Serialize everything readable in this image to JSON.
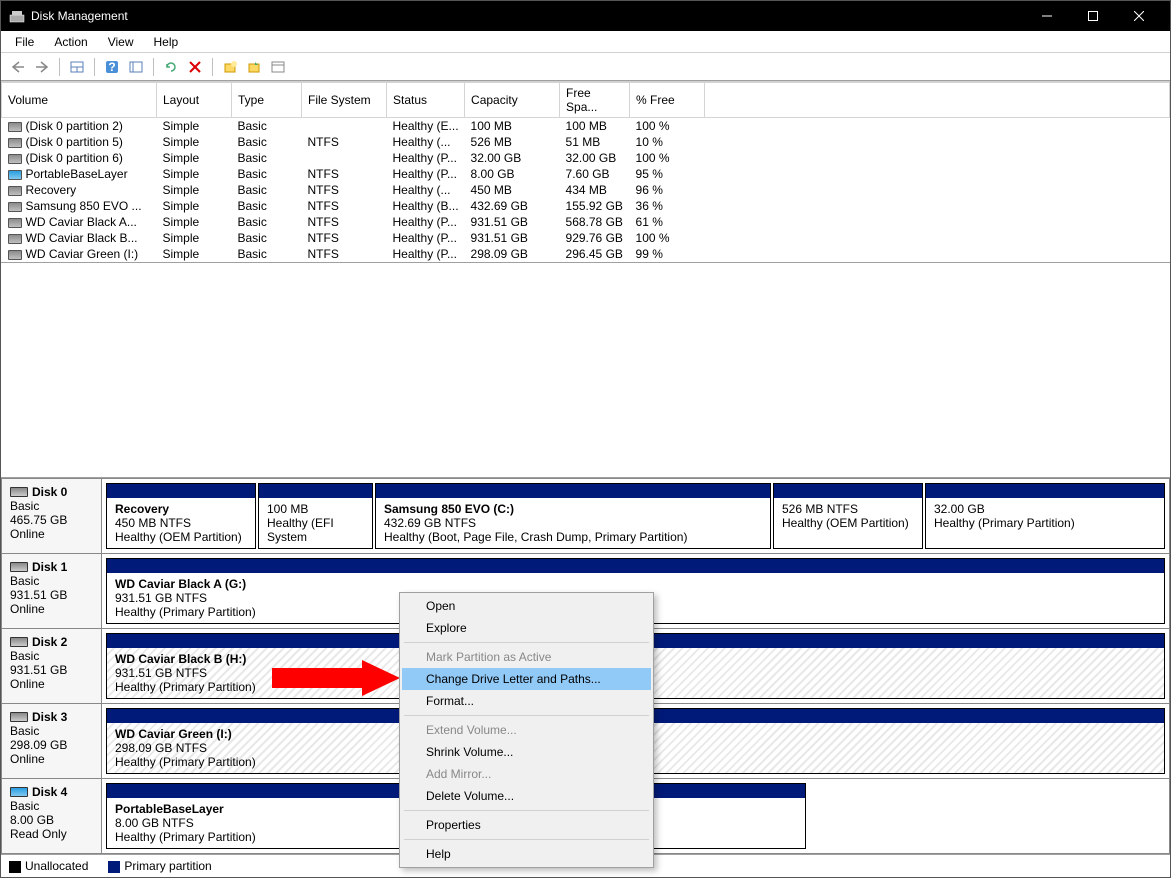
{
  "window": {
    "title": "Disk Management"
  },
  "menu": {
    "file": "File",
    "action": "Action",
    "view": "View",
    "help": "Help"
  },
  "columns": {
    "volume": "Volume",
    "layout": "Layout",
    "type": "Type",
    "fs": "File System",
    "status": "Status",
    "capacity": "Capacity",
    "free": "Free Spa...",
    "pct": "% Free"
  },
  "volumes": [
    {
      "name": "(Disk 0 partition 2)",
      "layout": "Simple",
      "type": "Basic",
      "fs": "",
      "status": "Healthy (E...",
      "cap": "100 MB",
      "free": "100 MB",
      "pct": "100 %",
      "icon": "gray"
    },
    {
      "name": "(Disk 0 partition 5)",
      "layout": "Simple",
      "type": "Basic",
      "fs": "NTFS",
      "status": "Healthy (...",
      "cap": "526 MB",
      "free": "51 MB",
      "pct": "10 %",
      "icon": "gray"
    },
    {
      "name": "(Disk 0 partition 6)",
      "layout": "Simple",
      "type": "Basic",
      "fs": "",
      "status": "Healthy (P...",
      "cap": "32.00 GB",
      "free": "32.00 GB",
      "pct": "100 %",
      "icon": "gray"
    },
    {
      "name": "PortableBaseLayer",
      "layout": "Simple",
      "type": "Basic",
      "fs": "NTFS",
      "status": "Healthy (P...",
      "cap": "8.00 GB",
      "free": "7.60 GB",
      "pct": "95 %",
      "icon": "blue"
    },
    {
      "name": "Recovery",
      "layout": "Simple",
      "type": "Basic",
      "fs": "NTFS",
      "status": "Healthy (...",
      "cap": "450 MB",
      "free": "434 MB",
      "pct": "96 %",
      "icon": "gray"
    },
    {
      "name": "Samsung 850 EVO ...",
      "layout": "Simple",
      "type": "Basic",
      "fs": "NTFS",
      "status": "Healthy (B...",
      "cap": "432.69 GB",
      "free": "155.92 GB",
      "pct": "36 %",
      "icon": "gray"
    },
    {
      "name": "WD Caviar Black A...",
      "layout": "Simple",
      "type": "Basic",
      "fs": "NTFS",
      "status": "Healthy (P...",
      "cap": "931.51 GB",
      "free": "568.78 GB",
      "pct": "61 %",
      "icon": "gray"
    },
    {
      "name": "WD Caviar Black B...",
      "layout": "Simple",
      "type": "Basic",
      "fs": "NTFS",
      "status": "Healthy (P...",
      "cap": "931.51 GB",
      "free": "929.76 GB",
      "pct": "100 %",
      "icon": "gray"
    },
    {
      "name": "WD Caviar Green (I:)",
      "layout": "Simple",
      "type": "Basic",
      "fs": "NTFS",
      "status": "Healthy (P...",
      "cap": "298.09 GB",
      "free": "296.45 GB",
      "pct": "99 %",
      "icon": "gray"
    }
  ],
  "disks": {
    "d0": {
      "name": "Disk 0",
      "type": "Basic",
      "size": "465.75 GB",
      "state": "Online"
    },
    "d0_parts": {
      "p1": {
        "name": "Recovery",
        "l2": "450 MB NTFS",
        "l3": "Healthy (OEM Partition)"
      },
      "p2": {
        "name": "",
        "l2": "100 MB",
        "l3": "Healthy (EFI System"
      },
      "p3": {
        "name": "Samsung 850 EVO  (C:)",
        "l2": "432.69 GB NTFS",
        "l3": "Healthy (Boot, Page File, Crash Dump, Primary Partition)"
      },
      "p4": {
        "name": "",
        "l2": "526 MB NTFS",
        "l3": "Healthy (OEM Partition)"
      },
      "p5": {
        "name": "",
        "l2": "32.00 GB",
        "l3": "Healthy (Primary Partition)"
      }
    },
    "d1": {
      "name": "Disk 1",
      "type": "Basic",
      "size": "931.51 GB",
      "state": "Online"
    },
    "d1_parts": {
      "p1": {
        "name": "WD Caviar Black A  (G:)",
        "l2": "931.51 GB NTFS",
        "l3": "Healthy (Primary Partition)"
      }
    },
    "d2": {
      "name": "Disk 2",
      "type": "Basic",
      "size": "931.51 GB",
      "state": "Online"
    },
    "d2_parts": {
      "p1": {
        "name": "WD Caviar Black B  (H:)",
        "l2": "931.51 GB NTFS",
        "l3": "Healthy (Primary Partition)"
      }
    },
    "d3": {
      "name": "Disk 3",
      "type": "Basic",
      "size": "298.09 GB",
      "state": "Online"
    },
    "d3_parts": {
      "p1": {
        "name": "WD Caviar Green  (I:)",
        "l2": "298.09 GB NTFS",
        "l3": "Healthy (Primary Partition)"
      }
    },
    "d4": {
      "name": "Disk 4",
      "type": "Basic",
      "size": "8.00 GB",
      "state": "Read Only"
    },
    "d4_parts": {
      "p1": {
        "name": "PortableBaseLayer",
        "l2": "8.00 GB NTFS",
        "l3": "Healthy (Primary Partition)"
      }
    }
  },
  "legend": {
    "unalloc": "Unallocated",
    "primary": "Primary partition"
  },
  "context": {
    "open": "Open",
    "explore": "Explore",
    "mark": "Mark Partition as Active",
    "change": "Change Drive Letter and Paths...",
    "format": "Format...",
    "extend": "Extend Volume...",
    "shrink": "Shrink Volume...",
    "mirror": "Add Mirror...",
    "delete": "Delete Volume...",
    "props": "Properties",
    "help": "Help"
  }
}
